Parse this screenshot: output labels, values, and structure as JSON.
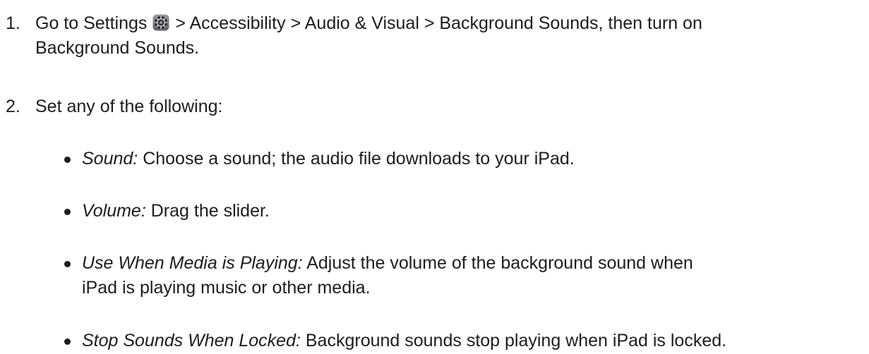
{
  "steps": [
    {
      "number": "1.",
      "text_before_icon": "Go to Settings ",
      "icon": "settings-gear-icon",
      "text_after_icon_line1": " > Accessibility > Audio & Visual > Background Sounds, then turn on",
      "text_line2": "Background Sounds."
    },
    {
      "number": "2.",
      "text": "Set any of the following:"
    }
  ],
  "options": [
    {
      "term": "Sound:",
      "desc": " Choose a sound; the audio file downloads to your iPad."
    },
    {
      "term": "Volume:",
      "desc": " Drag the slider."
    },
    {
      "term": "Use When Media is Playing:",
      "desc_line1": " Adjust the volume of the background sound when",
      "desc_line2": "iPad is playing music or other media."
    },
    {
      "term": "Stop Sounds When Locked:",
      "desc": " Background sounds stop playing when iPad is locked."
    }
  ]
}
